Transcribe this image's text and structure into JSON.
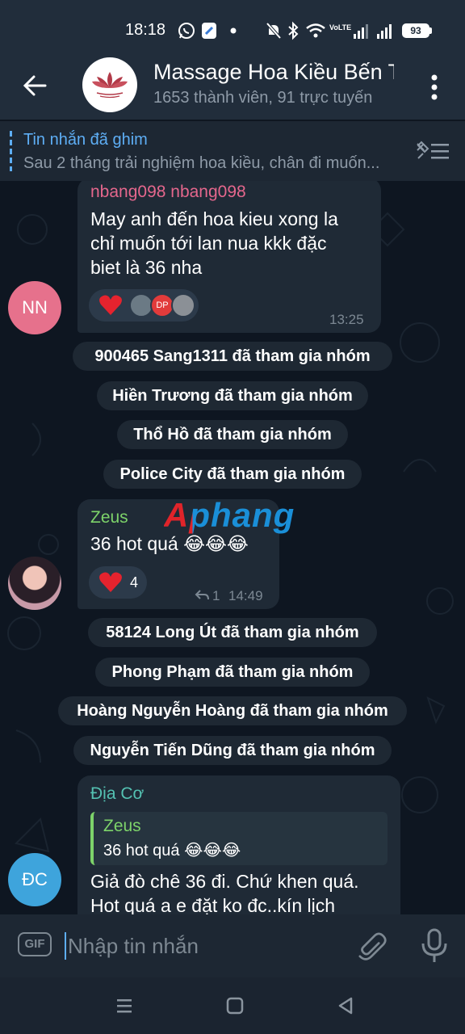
{
  "status_bar": {
    "time": "18:18",
    "network_label": "VoLTE",
    "battery": "93"
  },
  "header": {
    "title": "Massage Hoa Kiều Bến Thành",
    "subtitle": "1653 thành viên, 91 trực tuyến"
  },
  "pinned": {
    "title": "Tin nhắn đã ghim",
    "text": "Sau 2 tháng trải nghiệm hoa kiều, chân đi muốn..."
  },
  "watermark": "Aphang",
  "messages": [
    {
      "sender": "nbang098 nbang098",
      "sender_color": "#e5678d",
      "avatar_initials": "NN",
      "avatar_color": "#e6718c",
      "lines": [
        "May anh đến hoa kieu xong la",
        "chỉ muốn tới lan nua kkk đặc",
        "biet là 36 nha"
      ],
      "time": "13:25",
      "reaction_avatar_label": "DP"
    },
    {
      "sender": "Zeus",
      "sender_color": "#7dd36a",
      "text": "36 hot quá 😂😂😂",
      "reaction_count": "4",
      "replies": "1",
      "time": "14:49"
    },
    {
      "sender": "Địa Cơ",
      "sender_color": "#54c1b2",
      "avatar_initials": "ĐC",
      "avatar_color": "#3ea4dc",
      "quote_sender": "Zeus",
      "quote_text": "36 hot quá 😂😂😂",
      "lines": [
        "Giả đò chê 36 đi. Chứ khen quá.",
        "Hot quá a e đặt ko đc..kín lịch"
      ]
    }
  ],
  "system_messages": [
    "900465 Sang1311 đã tham gia nhóm",
    "Hiền Trương đã tham gia nhóm",
    "Thổ Hồ đã tham gia nhóm",
    "Police City đã tham gia nhóm",
    "58124 Long Út đã tham gia nhóm",
    "Phong Phạm đã tham gia nhóm",
    "Hoàng Nguyễn Hoàng đã tham gia nhóm",
    "Nguyễn Tiến Dũng đã tham gia nhóm"
  ],
  "input": {
    "gif_label": "GIF",
    "placeholder": "Nhập tin nhắn"
  },
  "icons": {
    "back": "back-arrow-icon",
    "menu": "more-vertical-icon",
    "unpin": "pinned-list-icon",
    "attach": "paperclip-icon",
    "mic": "microphone-icon",
    "heart": "heart-icon"
  }
}
